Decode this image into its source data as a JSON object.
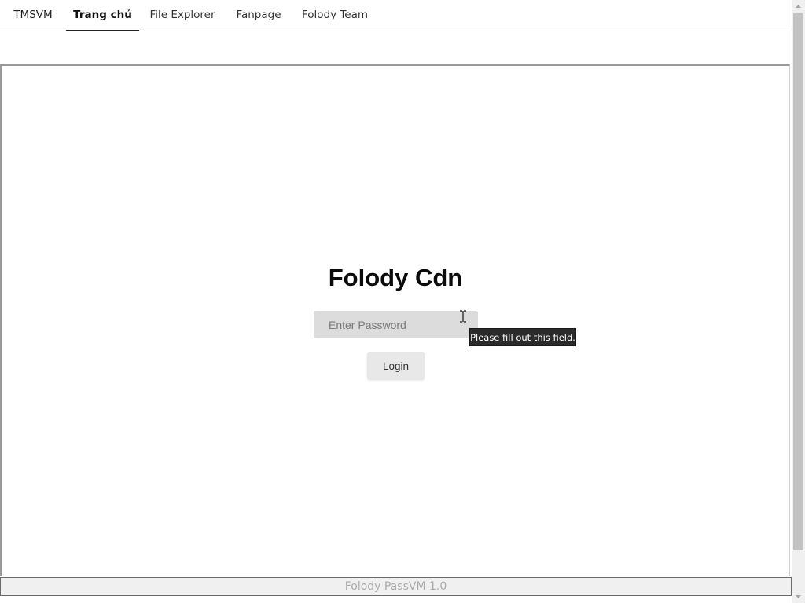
{
  "nav": {
    "brand": "TMSVM",
    "items": [
      {
        "label": "Trang chủ",
        "active": true
      },
      {
        "label": "File Explorer",
        "active": false
      },
      {
        "label": "Fanpage",
        "active": false
      },
      {
        "label": "Folody Team",
        "active": false
      }
    ]
  },
  "login": {
    "title": "Folody Cdn",
    "password_placeholder": "Enter Password",
    "password_value": "",
    "button_label": "Login",
    "validation_tooltip": "Please fill out this field."
  },
  "footer": {
    "text": "Folody PassVM 1.0"
  },
  "colors": {
    "input_bg": "#dcdcdc",
    "tooltip_bg": "#2b2b2b",
    "footer_bg": "#f0f0f0"
  },
  "icons": {
    "cursor": "text-cursor-icon",
    "scroll_up": "arrow-up-icon",
    "scroll_down": "arrow-down-icon"
  }
}
